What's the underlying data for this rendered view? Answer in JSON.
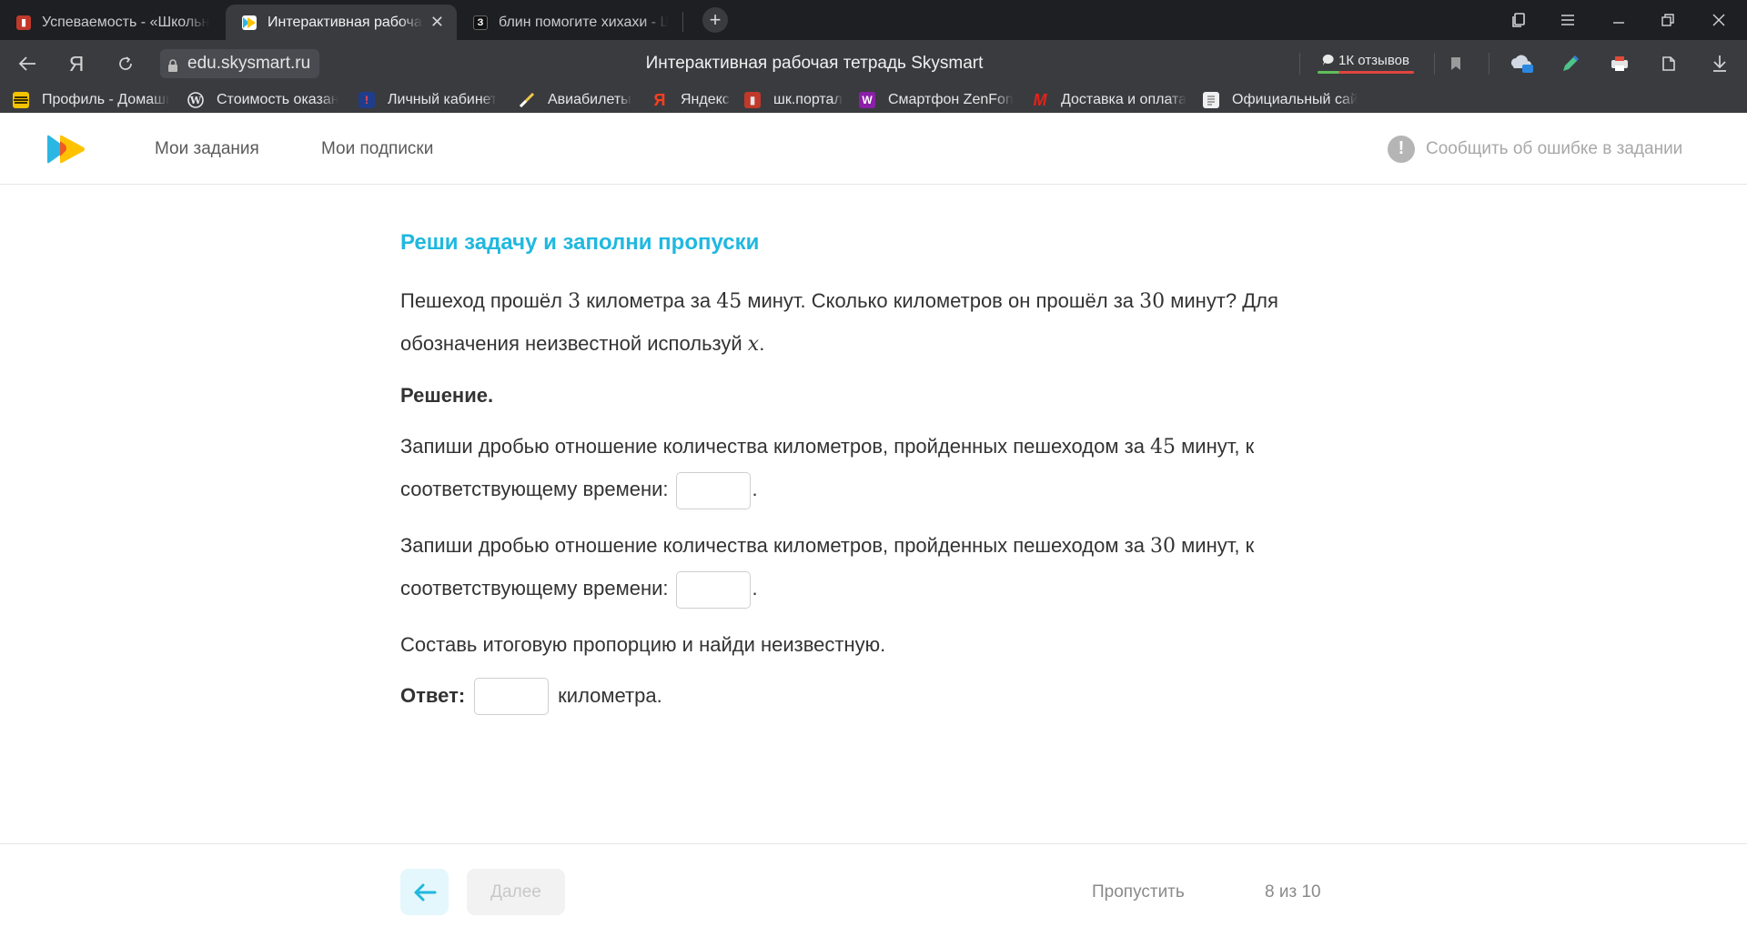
{
  "tabs": [
    {
      "label": "Успеваемость - «Школьный портал»",
      "icon": "school-portal-icon",
      "active": false
    },
    {
      "label": "Интерактивная рабочая тетрадь Skysmart",
      "icon": "skysmart-icon",
      "active": true
    },
    {
      "label": "блин помогите хихахи - Школьные Знания.com",
      "icon": "znanija-icon",
      "active": false
    }
  ],
  "address": {
    "domain": "edu.skysmart.ru",
    "page_title": "Интерактивная рабочая тетрадь Skysmart",
    "yandex_letter": "Я",
    "reviews": "1К отзывов"
  },
  "bookmarks": [
    {
      "label": "Профиль - Домашний интернет",
      "icon": "beeline-icon",
      "color": "#f4c300"
    },
    {
      "label": "Стоимость оказания услуг",
      "icon": "wordpress-icon",
      "color": "#e6e6e6"
    },
    {
      "label": "Личный кабинет",
      "icon": "cabinet-icon",
      "color": "#1f3d8a"
    },
    {
      "label": "Авиабилеты",
      "icon": "plane-icon",
      "color": "#f2c94c"
    },
    {
      "label": "Яндекс",
      "icon": "yandex-icon",
      "color": "#fc3f1d"
    },
    {
      "label": "шк.портал",
      "icon": "school-portal-icon",
      "color": "#c0392b"
    },
    {
      "label": "Смартфон ZenFone",
      "icon": "wildberries-icon",
      "color": "#8b1fa9"
    },
    {
      "label": "Доставка и оплата",
      "icon": "mvideo-icon",
      "color": "#e2231a"
    },
    {
      "label": "Официальный сайт",
      "icon": "document-icon",
      "color": "#f0f0f0"
    }
  ],
  "header": {
    "nav_tasks": "Мои задания",
    "nav_subscriptions": "Мои подписки",
    "report_error": "Сообщить об ошибке в задании",
    "report_icon_glyph": "!"
  },
  "task": {
    "title": "Реши задачу и заполни пропуски",
    "p1": {
      "t1": "Пешеход прошёл ",
      "n1": "3",
      "t2": " километра за ",
      "n2": "45",
      "t3": " минут. Сколько километров он прошёл за ",
      "n3": "30",
      "t4": " минут? Для обозначения неизвестной используй ",
      "var": "x",
      "t5": "."
    },
    "solution_label": "Решение.",
    "p2": {
      "t1": "Запиши дробью отношение количества километров, пройденных пешеходом за ",
      "n1": "45",
      "t2": " минут, к соответствующему времени:",
      "end": "."
    },
    "p3": {
      "t1": "Запиши дробью отношение количества километров, пройденных пешеходом за ",
      "n1": "30",
      "t2": " минут, к соответствующему времени:",
      "end": "."
    },
    "p4": "Составь итоговую пропорцию и найди неизвестную.",
    "answer_label": "Ответ:",
    "answer_unit": "километра."
  },
  "footer": {
    "next_label": "Далее",
    "skip_label": "Пропустить",
    "progress": "8 из 10"
  }
}
